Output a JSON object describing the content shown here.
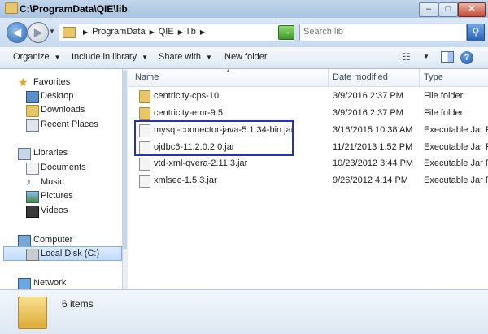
{
  "window": {
    "title": "C:\\ProgramData\\QIE\\lib",
    "buttons": {
      "minimize": "–",
      "maximize": "□",
      "close": "✕"
    }
  },
  "nav": {
    "breadcrumbs": [
      "ProgramData",
      "QIE",
      "lib"
    ],
    "search_placeholder": "Search lib"
  },
  "toolbar": {
    "organize": "Organize",
    "include_in_library": "Include in library",
    "share_with": "Share with",
    "new_folder": "New folder"
  },
  "sidebar": {
    "favorites": "Favorites",
    "desktop": "Desktop",
    "downloads": "Downloads",
    "recent_places": "Recent Places",
    "libraries": "Libraries",
    "documents": "Documents",
    "music": "Music",
    "pictures": "Pictures",
    "videos": "Videos",
    "computer": "Computer",
    "local_disk": "Local Disk (C:)",
    "network": "Network"
  },
  "columns": {
    "name": "Name",
    "date_modified": "Date modified",
    "type": "Type"
  },
  "files": [
    {
      "name": "centricity-cps-10",
      "date": "3/9/2016 2:37 PM",
      "type": "File folder",
      "kind": "folder"
    },
    {
      "name": "centricity-emr-9.5",
      "date": "3/9/2016 2:37 PM",
      "type": "File folder",
      "kind": "folder"
    },
    {
      "name": "mysql-connector-java-5.1.34-bin.jar",
      "date": "3/16/2015 10:38 AM",
      "type": "Executable Jar Fi",
      "kind": "jar"
    },
    {
      "name": "ojdbc6-11.2.0.2.0.jar",
      "date": "11/21/2013 1:52 PM",
      "type": "Executable Jar Fi",
      "kind": "jar"
    },
    {
      "name": "vtd-xml-qvera-2.11.3.jar",
      "date": "10/23/2012 3:44 PM",
      "type": "Executable Jar Fi",
      "kind": "jar"
    },
    {
      "name": "xmlsec-1.5.3.jar",
      "date": "9/26/2012 4:14 PM",
      "type": "Executable Jar Fi",
      "kind": "jar"
    }
  ],
  "status": {
    "item_count": "6 items"
  },
  "colors": {
    "highlight": "#2233bb",
    "folder": "#e8c66a"
  }
}
